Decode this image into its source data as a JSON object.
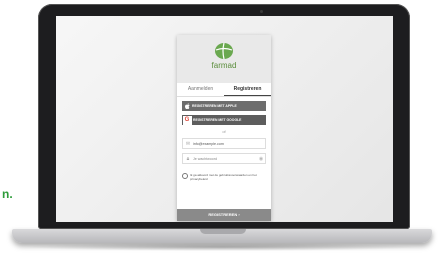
{
  "side_text": "n.",
  "brand": {
    "name": "farmad",
    "color": "#5a8d3b"
  },
  "tabs": [
    {
      "label": "Aanmelden",
      "active": false
    },
    {
      "label": "Registreren",
      "active": true
    }
  ],
  "buttons": {
    "apple_label": "REGISTREREN MET APPLE",
    "google_label": "REGISTREREN MET GOOGLE",
    "submit_label": "REGISTREREN ›"
  },
  "divider_text": "of",
  "fields": {
    "email_value": "info@example.com",
    "password_placeholder": "Je wachtwoord"
  },
  "consent_text": "Ik ga akkoord met de gebruiksvoorwaarden en het privacybeleid"
}
